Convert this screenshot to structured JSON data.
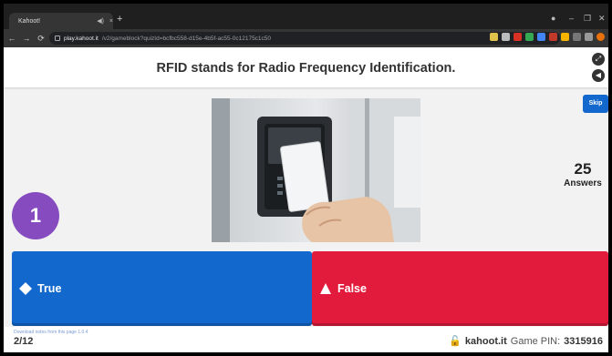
{
  "browser": {
    "tab_title": "Kahoot!",
    "tab_sound_icon": "speaker-icon",
    "tab_close": "×",
    "new_tab": "+",
    "url_host": "play.kahoot.it",
    "url_path": "/v2/gameblock?quizId=bcfbc558-d15e-4b5f-ac55-0c12175c1c50"
  },
  "question": {
    "text": "RFID stands for Radio Frequency Identification.",
    "number": "1",
    "answers_count": "25",
    "answers_label": "Answers"
  },
  "controls": {
    "skip_label": "Skip",
    "fullscreen_icon": "expand-icon",
    "sound_icon": "speaker-icon"
  },
  "options": [
    {
      "label": "True",
      "shape": "diamond",
      "color": "#1368ce"
    },
    {
      "label": "False",
      "shape": "triangle",
      "color": "#e21b3c"
    }
  ],
  "footer": {
    "progress": "2/12",
    "download_hint": "Download notes from this page 1.0.4",
    "brand": "kahoot.it",
    "pin_label": "Game PIN:",
    "pin_value": "3315916"
  },
  "colors": {
    "question_number_bg": "#864cbf",
    "skip_bg": "#1368ce"
  }
}
